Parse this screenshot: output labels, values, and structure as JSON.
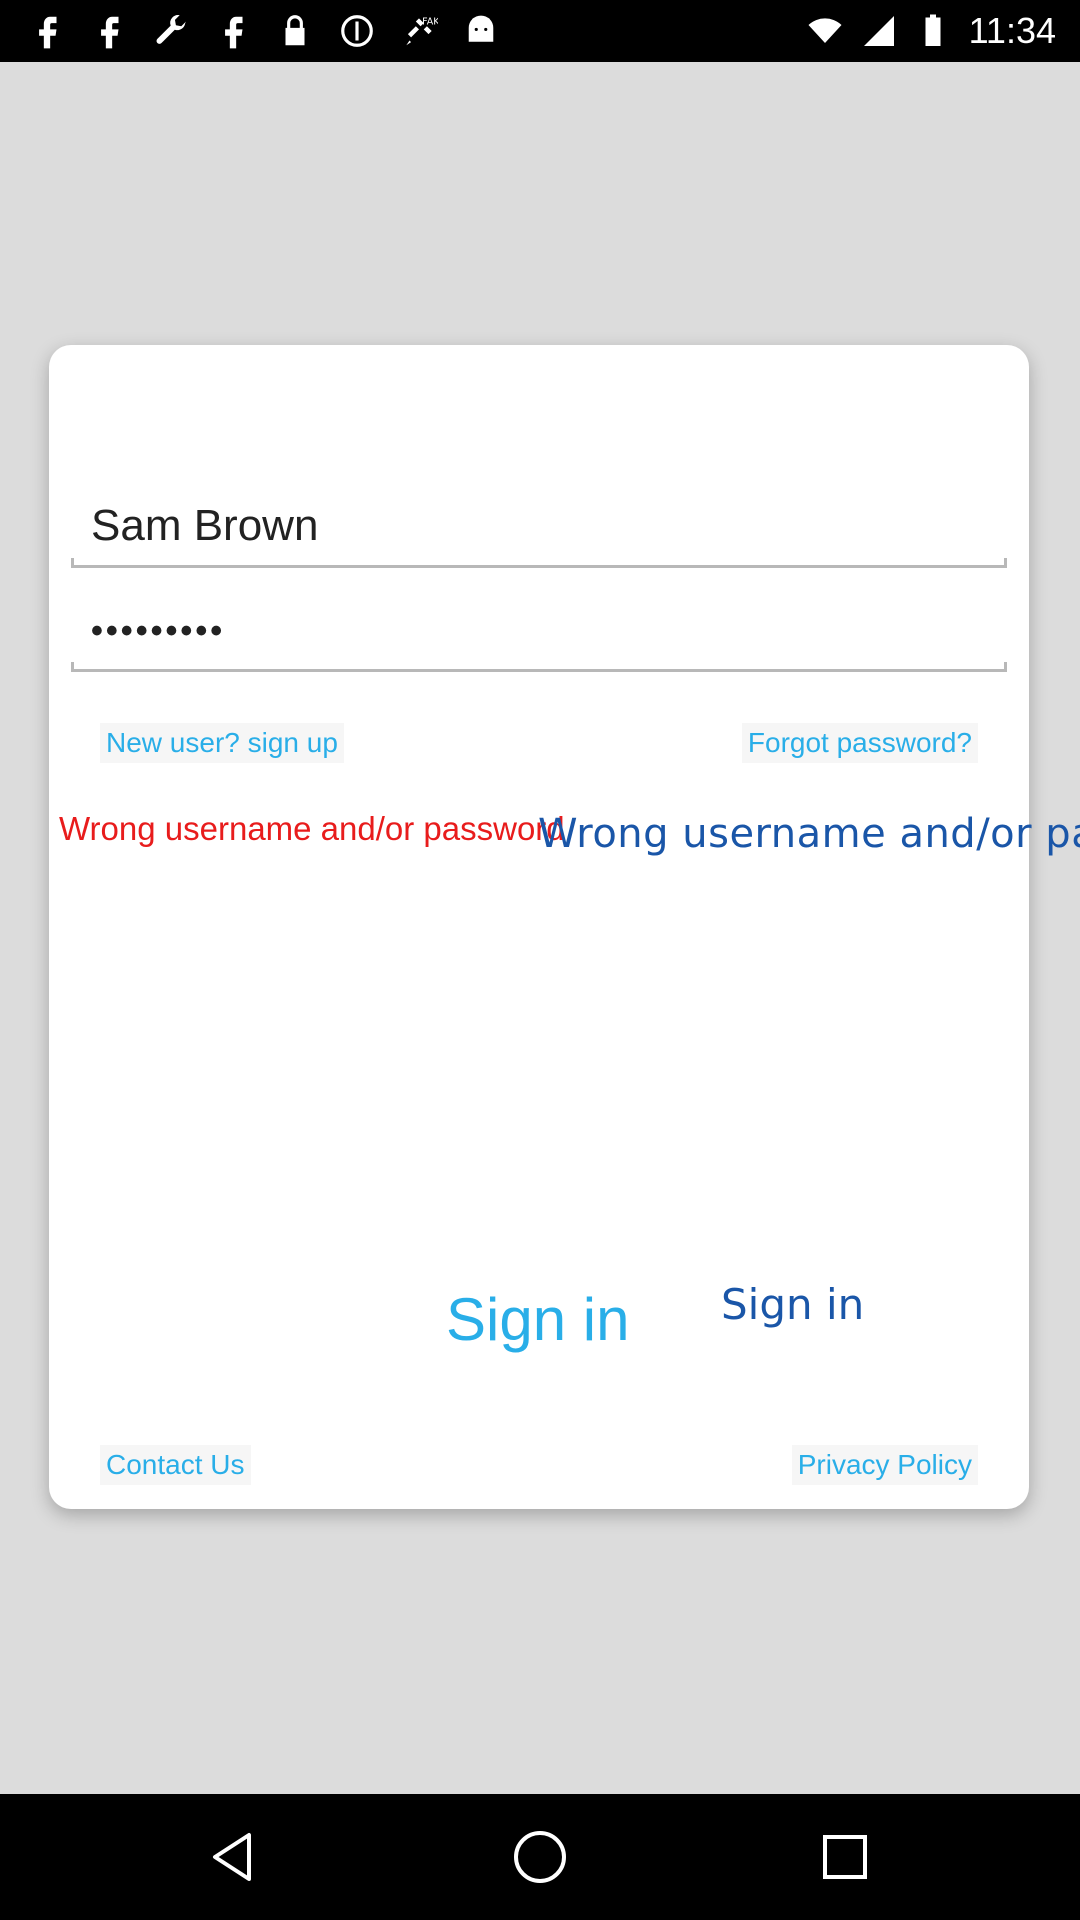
{
  "status_bar": {
    "time": "11:34",
    "left_icons": [
      "facebook-icon",
      "facebook-icon",
      "wrench-icon",
      "facebook-icon",
      "lock-icon",
      "info-icon",
      "fake-gps-icon",
      "android-icon"
    ],
    "right_icons": [
      "wifi-icon",
      "signal-icon",
      "battery-icon"
    ]
  },
  "login": {
    "username_value": "Sam Brown",
    "password_value": "•••••••••",
    "signup_link": "New user? sign up",
    "forgot_link": "Forgot password?",
    "error_message_red": "Wrong username and/or password",
    "error_message_blue": "Wrong username and/or pas",
    "sign_in_primary": "Sign in",
    "sign_in_secondary": "Sign in",
    "contact_link": "Contact Us",
    "privacy_link": "Privacy Policy"
  },
  "colors": {
    "background": "#dcdcdc",
    "card": "#ffffff",
    "accent_light_blue": "#29aee8",
    "accent_dark_blue": "#1a56a8",
    "error_red": "#e81c1c"
  },
  "nav_bar": {
    "buttons": [
      "back-icon",
      "home-icon",
      "recents-icon"
    ]
  }
}
